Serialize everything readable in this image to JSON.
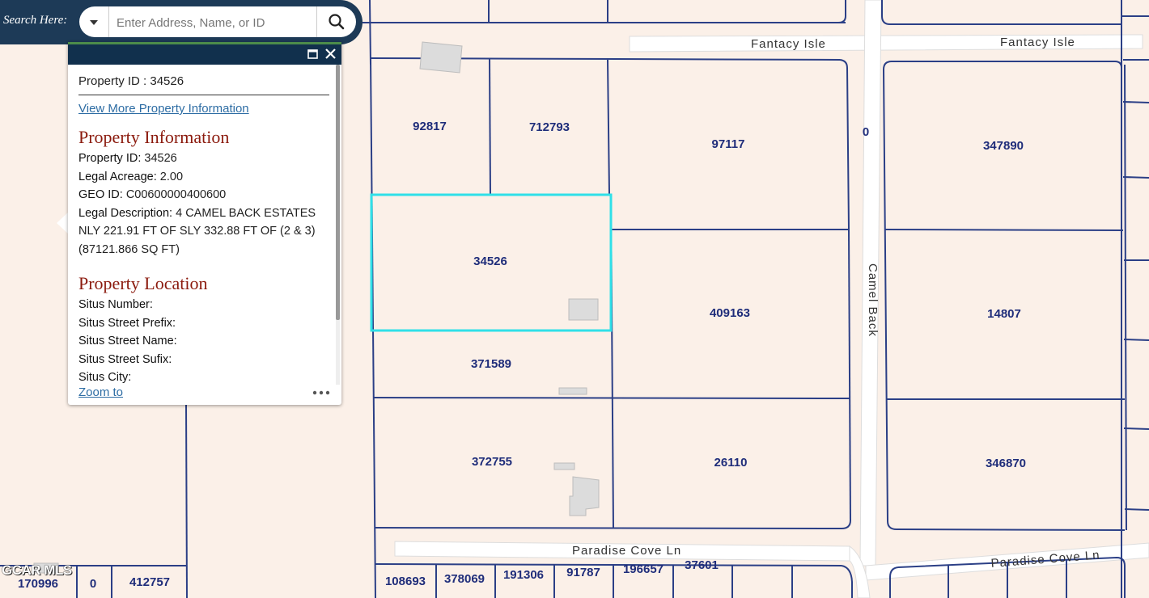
{
  "search": {
    "label": "Search Here:",
    "placeholder": "Enter Address, Name, or ID",
    "value": ""
  },
  "popup": {
    "header_title": "Property ID : 34526",
    "view_more_link": "View More Property Information",
    "section_info_title": "Property Information",
    "info_rows": [
      {
        "label": "Property ID:",
        "value": "34526"
      },
      {
        "label": "Legal Acreage:",
        "value": "2.00"
      },
      {
        "label": "GEO ID:",
        "value": "C00600000400600"
      },
      {
        "label": "Legal Description:",
        "value": "4 CAMEL BACK ESTATES NLY 221.91 FT OF SLY 332.88 FT OF (2 & 3) (87121.866 SQ FT)"
      }
    ],
    "section_location_title": "Property Location",
    "location_rows": [
      {
        "label": "Situs Number:",
        "value": ""
      },
      {
        "label": "Situs Street Prefix:",
        "value": ""
      },
      {
        "label": "Situs Street Name:",
        "value": ""
      },
      {
        "label": "Situs Street Sufix:",
        "value": ""
      },
      {
        "label": "Situs City:",
        "value": ""
      }
    ],
    "zoom_link": "Zoom to",
    "more_glyph": "•••"
  },
  "map": {
    "streets": {
      "fantacy_1": "Fantacy Isle",
      "fantacy_2": "Fantacy Isle",
      "camel_back": "Camel Back",
      "paradise_1": "Paradise Cove Ln",
      "paradise_2": "Paradise Cove Ln"
    },
    "parcels": {
      "p92817": "92817",
      "p712793": "712793",
      "p97117": "97117",
      "p347890": "347890",
      "p34526": "34526",
      "p409163": "409163",
      "p14807": "14807",
      "p371589": "371589",
      "p372755": "372755",
      "p26110": "26110",
      "p346870": "346870",
      "p0a": "0",
      "p0b": "0",
      "p170996": "170996",
      "p412757": "412757",
      "p108693": "108693",
      "p378069": "378069",
      "p191306": "191306",
      "p91787": "91787",
      "p196657": "196657",
      "p37601": "37601"
    },
    "colors": {
      "background": "#fbf0e8",
      "parcel_line": "#2b3f86",
      "selected_outline": "#30e0e8",
      "road": "#ffffff",
      "building": "#dcdcdc"
    }
  },
  "watermark": "GCAR MLS"
}
